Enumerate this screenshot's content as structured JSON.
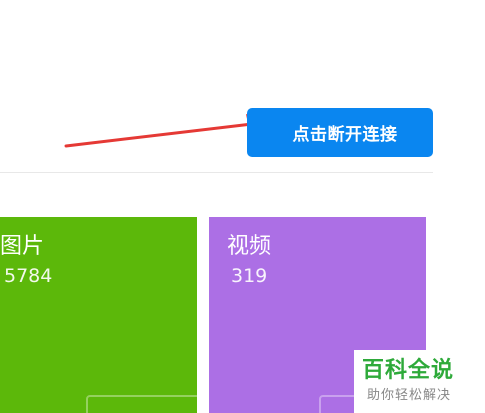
{
  "toolbar": {
    "disconnect_label": "点击断开连接"
  },
  "tiles": [
    {
      "title": "图片",
      "count": "5784",
      "color": "#5cb80a"
    },
    {
      "title": "视频",
      "count": "319",
      "color": "#ac6fe5"
    }
  ],
  "watermark": {
    "logo_text": "百科全说",
    "subtitle": "助你轻松解决"
  },
  "colors": {
    "accent": "#0a86f0",
    "arrow": "#e53935"
  },
  "icons": {
    "pointer": "red-arrow-icon"
  }
}
